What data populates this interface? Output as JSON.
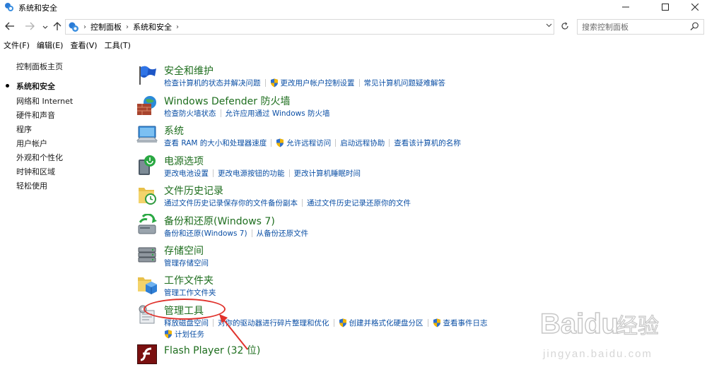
{
  "window": {
    "title": "系统和安全",
    "controls": [
      "minimize-icon",
      "maximize-icon",
      "close-icon"
    ]
  },
  "nav": {
    "breadcrumb": [
      "控制面板",
      "系统和安全"
    ],
    "search_placeholder": "搜索控制面板"
  },
  "menu": {
    "items": [
      "文件(F)",
      "编辑(E)",
      "查看(V)",
      "工具(T)"
    ]
  },
  "sidebar": {
    "items": [
      {
        "label": "控制面板主页",
        "active": false
      },
      {
        "label": "系统和安全",
        "active": true
      },
      {
        "label": "网络和 Internet",
        "active": false
      },
      {
        "label": "硬件和声音",
        "active": false
      },
      {
        "label": "程序",
        "active": false
      },
      {
        "label": "用户帐户",
        "active": false
      },
      {
        "label": "外观和个性化",
        "active": false
      },
      {
        "label": "时钟和区域",
        "active": false
      },
      {
        "label": "轻松使用",
        "active": false
      }
    ]
  },
  "categories": [
    {
      "title": "安全和维护",
      "icon": "flag-icon",
      "links": [
        {
          "label": "检查计算机的状态并解决问题",
          "shield": false
        },
        {
          "label": "更改用户帐户控制设置",
          "shield": true
        },
        {
          "label": "常见计算机问题疑难解答",
          "shield": false
        }
      ]
    },
    {
      "title": "Windows Defender 防火墙",
      "icon": "firewall-icon",
      "links": [
        {
          "label": "检查防火墙状态",
          "shield": false
        },
        {
          "label": "允许应用通过 Windows 防火墙",
          "shield": false
        }
      ]
    },
    {
      "title": "系统",
      "icon": "computer-icon",
      "links": [
        {
          "label": "查看 RAM 的大小和处理器速度",
          "shield": false
        },
        {
          "label": "允许远程访问",
          "shield": true
        },
        {
          "label": "启动远程协助",
          "shield": false
        },
        {
          "label": "查看该计算机的名称",
          "shield": false
        }
      ]
    },
    {
      "title": "电源选项",
      "icon": "power-icon",
      "links": [
        {
          "label": "更改电池设置",
          "shield": false
        },
        {
          "label": "更改电源按钮的功能",
          "shield": false
        },
        {
          "label": "更改计算机睡眠时间",
          "shield": false
        }
      ]
    },
    {
      "title": "文件历史记录",
      "icon": "file-history-icon",
      "links": [
        {
          "label": "通过文件历史记录保存你的文件备份副本",
          "shield": false
        },
        {
          "label": "通过文件历史记录还原你的文件",
          "shield": false
        }
      ]
    },
    {
      "title": "备份和还原(Windows 7)",
      "icon": "backup-icon",
      "links": [
        {
          "label": "备份和还原(Windows 7)",
          "shield": false
        },
        {
          "label": "从备份还原文件",
          "shield": false
        }
      ]
    },
    {
      "title": "存储空间",
      "icon": "storage-icon",
      "links": [
        {
          "label": "管理存储空间",
          "shield": false
        }
      ]
    },
    {
      "title": "工作文件夹",
      "icon": "work-folders-icon",
      "links": [
        {
          "label": "管理工作文件夹",
          "shield": false
        }
      ]
    },
    {
      "title": "管理工具",
      "icon": "admin-tools-icon",
      "links": [
        {
          "label": "释放磁盘空间",
          "shield": false
        },
        {
          "label": "对你的驱动器进行碎片整理和优化",
          "shield": false
        },
        {
          "label": "创建并格式化硬盘分区",
          "shield": true
        },
        {
          "label": "查看事件日志",
          "shield": true
        }
      ],
      "links_row2": [
        {
          "label": "计划任务",
          "shield": true
        }
      ]
    },
    {
      "title": "Flash Player (32 位)",
      "icon": "flash-icon",
      "links": []
    }
  ],
  "colors": {
    "category_title": "#1e6e1e",
    "link": "#0b4fa5",
    "annotation": "#e0322c"
  },
  "watermark": {
    "brand": "Baidu",
    "cn": "经验",
    "url": "jingyan.baidu.com"
  }
}
